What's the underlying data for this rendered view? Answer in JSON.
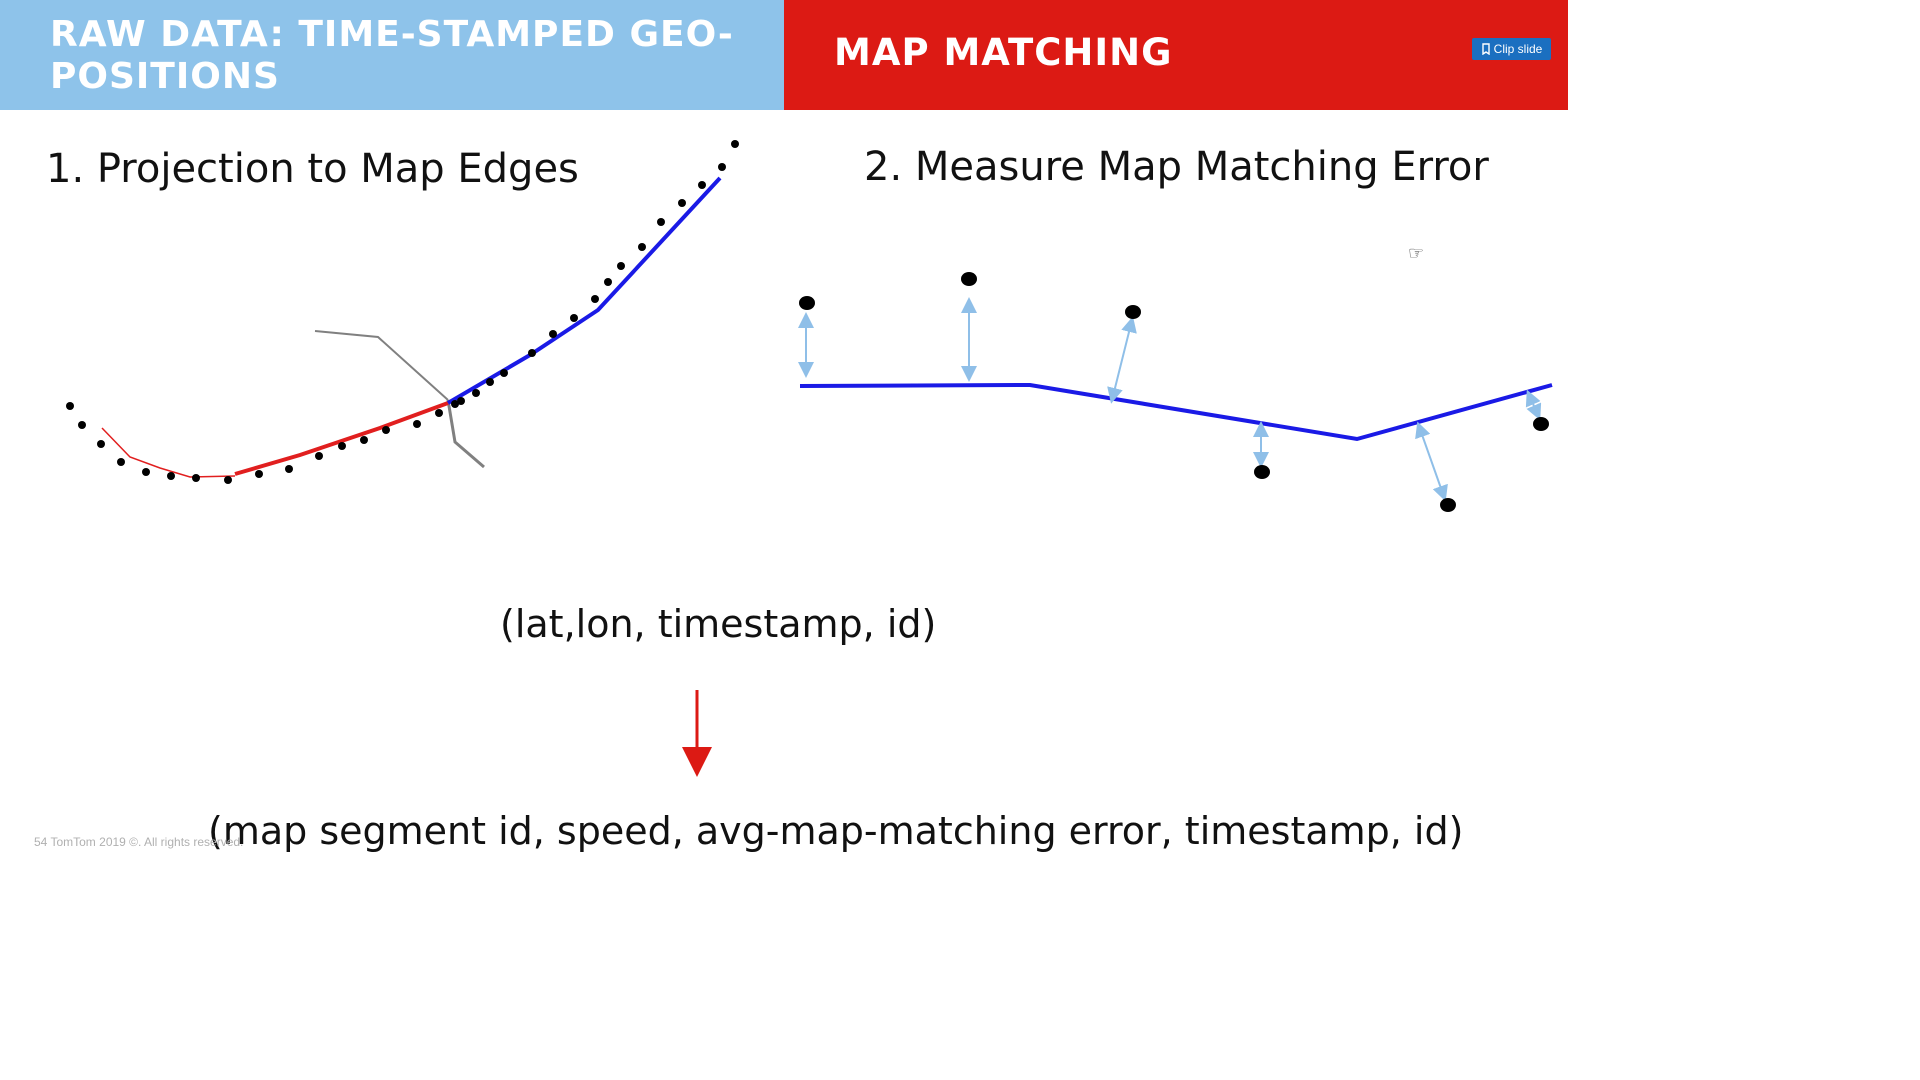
{
  "header": {
    "left_title": "RAW DATA: TIME-STAMPED GEO-POSITIONS",
    "right_title": "MAP MATCHING",
    "clip_button": "Clip slide",
    "left_color": "#8ec3ea",
    "right_color": "#dc1a14"
  },
  "section1": {
    "heading": "1. Projection to Map Edges"
  },
  "section2": {
    "heading": "2. Measure Map Matching Error"
  },
  "formula": {
    "input": "(lat,lon, timestamp, id)",
    "output": "(map segment id, speed, avg-map-matching error, timestamp, id)",
    "arrow_color": "#dc1a14"
  },
  "footer": {
    "text": "54  TomTom 2019 ©. All rights reserved."
  },
  "icons": [
    "clip-icon",
    "pointer-hand-icon"
  ],
  "colors": {
    "matched_segment": "#e11f1f",
    "road_blue": "#1a1ae6",
    "error_arrow": "#8fbfe8",
    "road_gray": "#808080"
  }
}
